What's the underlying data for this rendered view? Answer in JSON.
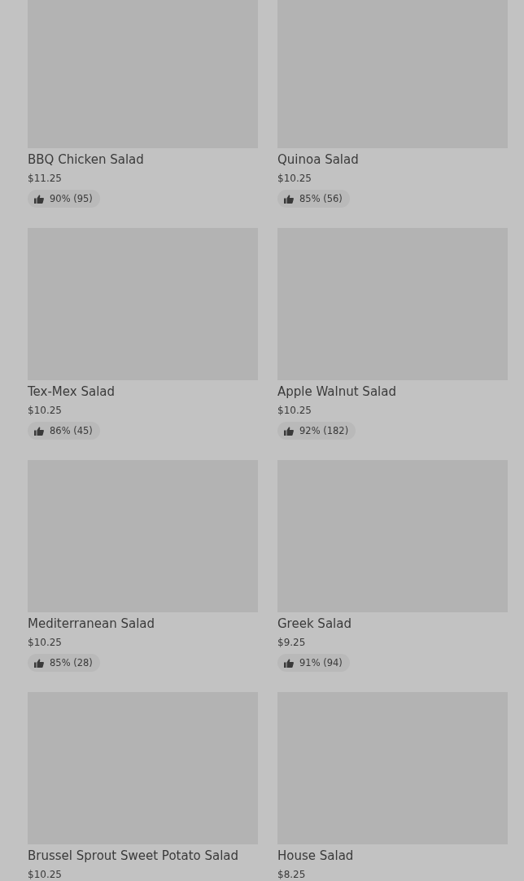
{
  "items": [
    {
      "name": "BBQ Chicken Salad",
      "price": "$11.25",
      "rating": "90% (95)"
    },
    {
      "name": "Quinoa Salad",
      "price": "$10.25",
      "rating": "85% (56)"
    },
    {
      "name": "Tex-Mex Salad",
      "price": "$10.25",
      "rating": "86% (45)"
    },
    {
      "name": "Apple Walnut Salad",
      "price": "$10.25",
      "rating": "92% (182)"
    },
    {
      "name": "Mediterranean Salad",
      "price": "$10.25",
      "rating": "85% (28)"
    },
    {
      "name": "Greek Salad",
      "price": "$9.25",
      "rating": "91% (94)"
    },
    {
      "name": "Brussel Sprout Sweet Potato Salad",
      "price": "$10.25"
    },
    {
      "name": "House Salad",
      "price": "$8.25"
    }
  ]
}
